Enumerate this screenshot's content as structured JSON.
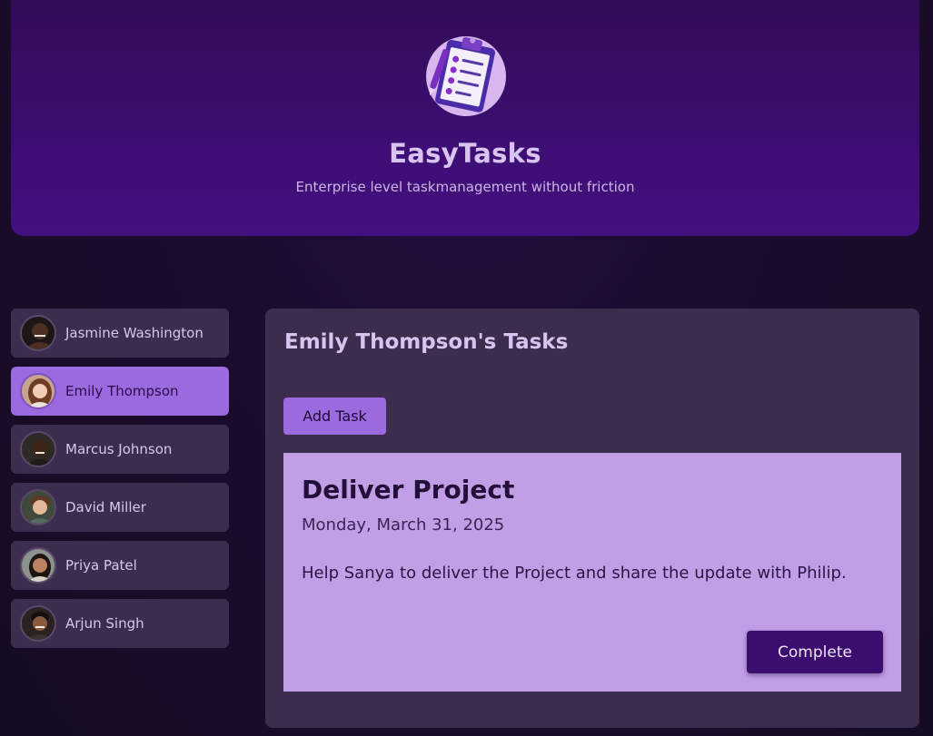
{
  "header": {
    "logo_icon": "clipboard-checklist-icon",
    "title": "EasyTasks",
    "subtitle": "Enterprise level taskmanagement without friction"
  },
  "users": [
    {
      "name": "Jasmine Washington",
      "avatar": "avatar-photo",
      "active": false
    },
    {
      "name": "Emily Thompson",
      "avatar": "avatar-photo",
      "active": true
    },
    {
      "name": "Marcus Johnson",
      "avatar": "avatar-photo",
      "active": false
    },
    {
      "name": "David Miller",
      "avatar": "avatar-photo",
      "active": false
    },
    {
      "name": "Priya Patel",
      "avatar": "avatar-photo",
      "active": false
    },
    {
      "name": "Arjun Singh",
      "avatar": "avatar-photo",
      "active": false
    }
  ],
  "tasks_panel": {
    "title": "Emily Thompson's Tasks",
    "add_label": "Add Task",
    "task": {
      "title": "Deliver Project",
      "date": "Monday, March 31, 2025",
      "description": "Help Sanya to deliver the Project and share the update with Philip.",
      "complete_label": "Complete"
    }
  },
  "colors": {
    "accent": "#9b6adf",
    "header_bg": "#3f0e77",
    "panel_bg": "#3c2d4e",
    "card_bg": "#c19fe6",
    "complete_bg": "#3a0d6e"
  }
}
